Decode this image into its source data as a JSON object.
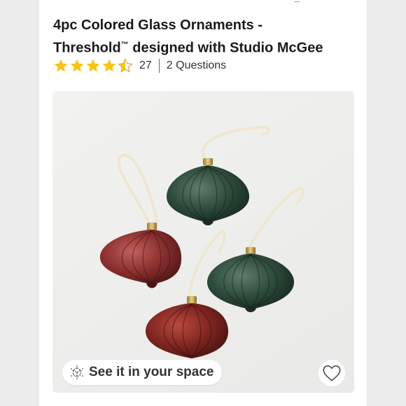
{
  "product": {
    "title_line1": "4pc Colored Glass Ornaments -",
    "title_brand": "Threshold",
    "title_tm": "™",
    "title_rest": " designed with Studio McGee",
    "rating": 4.5,
    "review_count": "27",
    "questions_label": "2 Questions"
  },
  "image": {
    "ar_button_label": "See it in your space",
    "ar_icon": "ar-cube-icon",
    "favorite_icon": "heart-outline-icon"
  },
  "colors": {
    "star_fill": "#f5c518",
    "title_text": "#1b1b1b",
    "ornament_red": "#8a2f2e",
    "ornament_green": "#2c4a3a"
  }
}
